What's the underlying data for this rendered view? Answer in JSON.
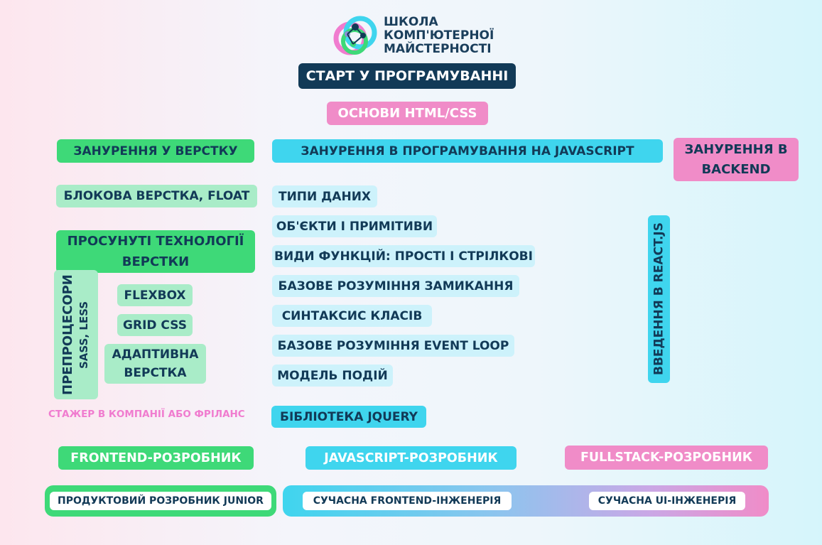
{
  "logo": {
    "line1": "ШКОЛА",
    "line2": "КОМП'ЮТЕРНОЇ",
    "line3": "МАЙСТЕРНОСТІ"
  },
  "header": {
    "start": "СТАРТ У ПРОГРАМУВАННІ",
    "basics": "ОСНОВИ HTML/CSS"
  },
  "columns": {
    "layout_title": "ЗАНУРЕННЯ У ВЕРСТКУ",
    "js_title": "ЗАНУРЕННЯ В ПРОГРАМУВАННЯ НА JAVASCRIPT",
    "backend_title": "ЗАНУРЕННЯ В BACKEND"
  },
  "layout": {
    "block": "БЛОКОВА ВЕРСТКА, FLOAT",
    "advanced": "ПРОСУНУТІ ТЕХНОЛОГІЇ ВЕРСТКИ",
    "preprocessors": "ПРЕПРОЦЕСОРИ",
    "preprocessors_sub": "SASS, LESS",
    "flexbox": "FLEXBOX",
    "grid": "GRID CSS",
    "adaptive": "АДАПТИВНА ВЕРСТКА",
    "intern": "СТАЖЕР В КОМПАНІЇ АБО ФРІЛАНС"
  },
  "js": {
    "items": [
      "ТИПИ ДАНИХ",
      "ОБ'ЄКТИ І ПРИМІТИВИ",
      "ВИДИ ФУНКЦІЙ: ПРОСТІ І СТРІЛКОВІ",
      "БАЗОВЕ РОЗУМІННЯ ЗАМИКАННЯ",
      "СИНТАКСИС КЛАСІВ",
      "БАЗОВЕ РОЗУМІННЯ EVENT LOOP",
      "МОДЕЛЬ ПОДІЙ"
    ],
    "jquery": "БІБЛІОТЕКА JQUERY",
    "react": "ВВЕДЕННЯ В REACT.JS"
  },
  "roles": {
    "frontend": "FRONTEND-РОЗРОБНИК",
    "javascript": "JAVASCRIPT-РОЗРОБНИК",
    "fullstack": "FULLSTACK-РОЗРОБНИК"
  },
  "bottom": {
    "junior": "ПРОДУКТОВИЙ РОЗРОБНИК JUNIOR",
    "frontend_eng": "СУЧАСНА FRONTEND-ІНЖЕНЕРІЯ",
    "ui_eng": "СУЧАСНА UI-ІНЖЕНЕРІЯ"
  },
  "colors": {
    "navy": "#123a57",
    "pink": "#f08cc8",
    "green": "#3ed978",
    "mint": "#a9ecc8",
    "cyan": "#3fd5ee",
    "light_cyan": "#cdf2fb"
  }
}
